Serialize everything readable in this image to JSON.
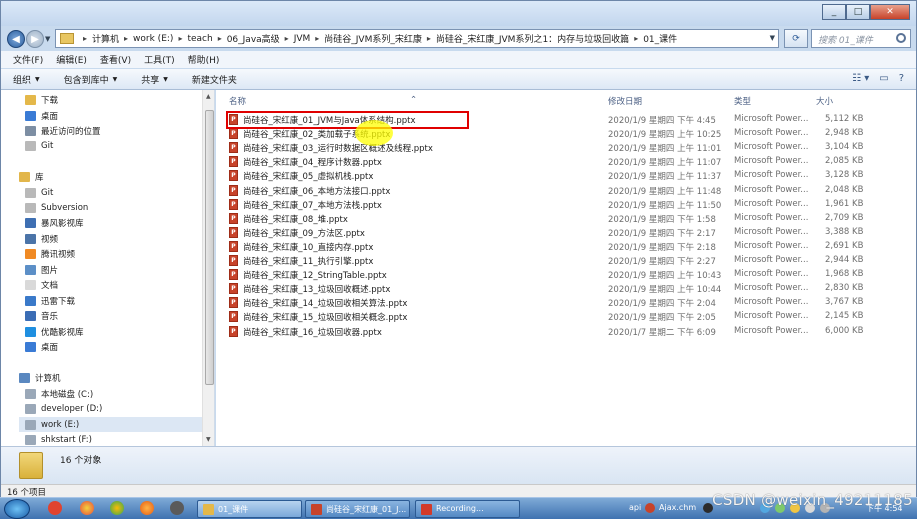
{
  "window_controls": {
    "minimize": "_",
    "maximize": "□",
    "close": "✕"
  },
  "address": {
    "crumbs": [
      "计算机",
      "work (E:)",
      "teach",
      "06_Java高级",
      "JVM",
      "尚硅谷_JVM系列_宋红康",
      "尚硅谷_宋红康_JVM系列之1：内存与垃圾回收篇",
      "01_课件"
    ],
    "search_placeholder": "搜索 01_课件"
  },
  "menu": [
    "文件(F)",
    "编辑(E)",
    "查看(V)",
    "工具(T)",
    "帮助(H)"
  ],
  "toolbar": {
    "organize": "组织",
    "include": "包含到库中",
    "share": "共享",
    "new_folder": "新建文件夹"
  },
  "columns": {
    "name": "名称",
    "date": "修改日期",
    "type": "类型",
    "size": "大小"
  },
  "nav": [
    {
      "label": "下载",
      "icon": "download-folder-icon",
      "color": "#e4b84a"
    },
    {
      "label": "桌面",
      "icon": "desktop-icon",
      "color": "#3a7bd5"
    },
    {
      "label": "最近访问的位置",
      "icon": "recent-places-icon",
      "color": "#7d8ea3"
    },
    {
      "label": "Git",
      "icon": "folder-icon",
      "color": "#b9b9b9"
    },
    {
      "label": "库",
      "icon": "libraries-icon",
      "color": "#e2b64b"
    },
    {
      "label": "Git",
      "icon": "folder-icon",
      "color": "#b9b9b9"
    },
    {
      "label": "Subversion",
      "icon": "folder-icon",
      "color": "#b9b9b9"
    },
    {
      "label": "暴风影视库",
      "icon": "video-library-icon",
      "color": "#3e6fb2"
    },
    {
      "label": "视频",
      "icon": "video-icon",
      "color": "#4b74a8"
    },
    {
      "label": "腾讯视频",
      "icon": "tencent-video-icon",
      "color": "#f08a24"
    },
    {
      "label": "图片",
      "icon": "pictures-icon",
      "color": "#5c8fc7"
    },
    {
      "label": "文档",
      "icon": "documents-icon",
      "color": "#d9d9d9"
    },
    {
      "label": "迅雷下载",
      "icon": "thunder-download-icon",
      "color": "#3a79c9"
    },
    {
      "label": "音乐",
      "icon": "music-icon",
      "color": "#3b6db5"
    },
    {
      "label": "优酷影视库",
      "icon": "youku-library-icon",
      "color": "#1f8fe0"
    },
    {
      "label": "桌面",
      "icon": "desktop-icon",
      "color": "#3a7bd5"
    },
    {
      "label": "计算机",
      "icon": "computer-icon",
      "color": "#5a88c0"
    },
    {
      "label": "本地磁盘 (C:)",
      "icon": "drive-icon",
      "color": "#9aa8b8"
    },
    {
      "label": "developer (D:)",
      "icon": "drive-icon",
      "color": "#9aa8b8"
    },
    {
      "label": "work (E:)",
      "icon": "drive-icon",
      "color": "#9aa8b8"
    },
    {
      "label": "shkstart (F:)",
      "icon": "drive-icon",
      "color": "#9aa8b8"
    }
  ],
  "files": [
    {
      "name": "尚硅谷_宋红康_01_JVM与Java体系结构.pptx",
      "date": "2020/1/9 星期四 下午 4:45",
      "type": "Microsoft Power...",
      "size": "5,112 KB"
    },
    {
      "name": "尚硅谷_宋红康_02_类加载子系统.pptx",
      "date": "2020/1/9 星期四 上午 10:25",
      "type": "Microsoft Power...",
      "size": "2,948 KB"
    },
    {
      "name": "尚硅谷_宋红康_03_运行时数据区概述及线程.pptx",
      "date": "2020/1/9 星期四 上午 11:01",
      "type": "Microsoft Power...",
      "size": "3,104 KB"
    },
    {
      "name": "尚硅谷_宋红康_04_程序计数器.pptx",
      "date": "2020/1/9 星期四 上午 11:07",
      "type": "Microsoft Power...",
      "size": "2,085 KB"
    },
    {
      "name": "尚硅谷_宋红康_05_虚拟机栈.pptx",
      "date": "2020/1/9 星期四 上午 11:37",
      "type": "Microsoft Power...",
      "size": "3,128 KB"
    },
    {
      "name": "尚硅谷_宋红康_06_本地方法接口.pptx",
      "date": "2020/1/9 星期四 上午 11:48",
      "type": "Microsoft Power...",
      "size": "2,048 KB"
    },
    {
      "name": "尚硅谷_宋红康_07_本地方法栈.pptx",
      "date": "2020/1/9 星期四 上午 11:50",
      "type": "Microsoft Power...",
      "size": "1,961 KB"
    },
    {
      "name": "尚硅谷_宋红康_08_堆.pptx",
      "date": "2020/1/9 星期四 下午 1:58",
      "type": "Microsoft Power...",
      "size": "2,709 KB"
    },
    {
      "name": "尚硅谷_宋红康_09_方法区.pptx",
      "date": "2020/1/9 星期四 下午 2:17",
      "type": "Microsoft Power...",
      "size": "3,388 KB"
    },
    {
      "name": "尚硅谷_宋红康_10_直接内存.pptx",
      "date": "2020/1/9 星期四 下午 2:18",
      "type": "Microsoft Power...",
      "size": "2,691 KB"
    },
    {
      "name": "尚硅谷_宋红康_11_执行引擎.pptx",
      "date": "2020/1/9 星期四 下午 2:27",
      "type": "Microsoft Power...",
      "size": "2,944 KB"
    },
    {
      "name": "尚硅谷_宋红康_12_StringTable.pptx",
      "date": "2020/1/9 星期四 上午 10:43",
      "type": "Microsoft Power...",
      "size": "1,968 KB"
    },
    {
      "name": "尚硅谷_宋红康_13_垃圾回收概述.pptx",
      "date": "2020/1/9 星期四 上午 10:44",
      "type": "Microsoft Power...",
      "size": "2,830 KB"
    },
    {
      "name": "尚硅谷_宋红康_14_垃圾回收相关算法.pptx",
      "date": "2020/1/9 星期四 下午 2:04",
      "type": "Microsoft Power...",
      "size": "3,767 KB"
    },
    {
      "name": "尚硅谷_宋红康_15_垃圾回收相关概念.pptx",
      "date": "2020/1/9 星期四 下午 2:05",
      "type": "Microsoft Power...",
      "size": "2,145 KB"
    },
    {
      "name": "尚硅谷_宋红康_16_垃圾回收器.pptx",
      "date": "2020/1/7 星期二 下午 6:09",
      "type": "Microsoft Power...",
      "size": "6,000 KB"
    }
  ],
  "details": {
    "count": "16 个对象"
  },
  "status": {
    "items": "16 个项目"
  },
  "taskbar": {
    "tasks": [
      {
        "label": "01_课件",
        "icon": "folder-icon",
        "color": "#e4b84a"
      },
      {
        "label": "尚硅谷_宋红康_01_J...",
        "icon": "powerpoint-icon",
        "color": "#c7432a"
      },
      {
        "label": "Recording...",
        "icon": "recording-icon",
        "color": "#d23a2a"
      }
    ],
    "tray_api": "api",
    "tray_chm": "Ajax.chm",
    "time": "下午 4:54"
  },
  "watermark": "CSDN @weixin_49211185"
}
